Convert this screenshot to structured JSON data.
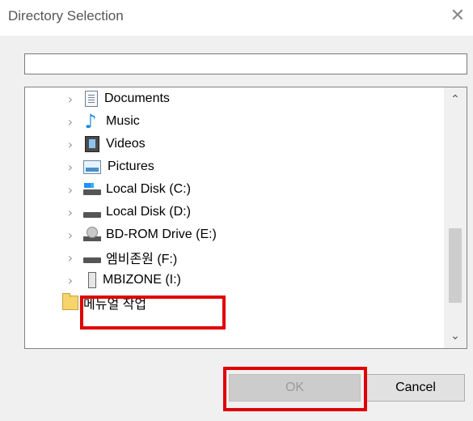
{
  "dialog": {
    "title": "Directory Selection",
    "close_glyph": "✕"
  },
  "path_input": {
    "value": "",
    "placeholder": ""
  },
  "tree": {
    "items": [
      {
        "label": "Documents",
        "icon": "documents-icon"
      },
      {
        "label": "Music",
        "icon": "music-icon"
      },
      {
        "label": "Videos",
        "icon": "videos-icon"
      },
      {
        "label": "Pictures",
        "icon": "pictures-icon"
      },
      {
        "label": "Local Disk (C:)",
        "icon": "system-drive-icon"
      },
      {
        "label": "Local Disk (D:)",
        "icon": "drive-icon"
      },
      {
        "label": "BD-ROM Drive (E:)",
        "icon": "optical-drive-icon"
      },
      {
        "label": "엠비존원 (F:)",
        "icon": "drive-icon"
      },
      {
        "label": "MBIZONE (I:)",
        "icon": "usb-drive-icon"
      },
      {
        "label": "메뉴얼 작업",
        "icon": "folder-icon"
      }
    ],
    "scroll_up": "⌃",
    "scroll_down": "⌄"
  },
  "buttons": {
    "ok": "OK",
    "cancel": "Cancel"
  },
  "colors": {
    "highlight": "#e00000",
    "ok_disabled_bg": "#cccccc"
  }
}
